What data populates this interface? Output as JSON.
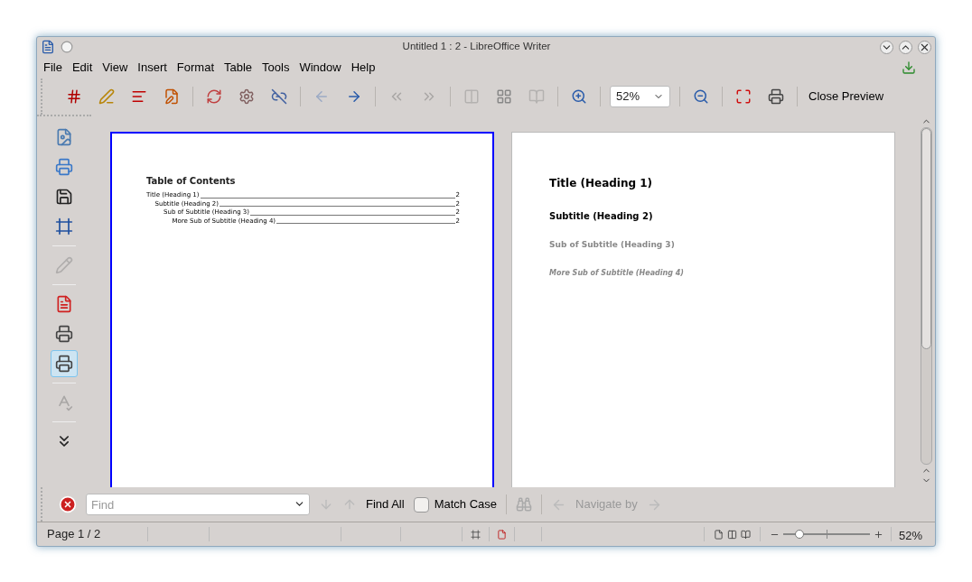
{
  "window": {
    "title": "Untitled 1 : 2 - LibreOffice Writer"
  },
  "menu": [
    {
      "label": "File"
    },
    {
      "label": "Edit"
    },
    {
      "label": "View"
    },
    {
      "label": "Insert"
    },
    {
      "label": "Format"
    },
    {
      "label": "Table"
    },
    {
      "label": "Tools"
    },
    {
      "label": "Window"
    },
    {
      "label": "Help"
    }
  ],
  "toolbar": [
    {
      "kind": "field-number",
      "disabled": false
    },
    {
      "kind": "field-edit",
      "disabled": false
    },
    {
      "kind": "list-lines",
      "disabled": false
    },
    {
      "kind": "list-edit",
      "disabled": false
    },
    {
      "kind": "separator"
    },
    {
      "kind": "refresh",
      "disabled": false
    },
    {
      "kind": "gear",
      "disabled": false
    },
    {
      "kind": "unlink",
      "disabled": false
    },
    {
      "kind": "separator"
    },
    {
      "kind": "arrow-left",
      "disabled": true
    },
    {
      "kind": "arrow-right",
      "disabled": false
    },
    {
      "kind": "separator"
    },
    {
      "kind": "first-page",
      "disabled": true
    },
    {
      "kind": "last-page",
      "disabled": true
    },
    {
      "kind": "separator"
    },
    {
      "kind": "two-pages",
      "disabled": true
    },
    {
      "kind": "multi-page",
      "disabled": false
    },
    {
      "kind": "book",
      "disabled": true
    },
    {
      "kind": "separator"
    },
    {
      "kind": "zoom-in",
      "disabled": false
    },
    {
      "kind": "separator"
    },
    {
      "kind": "zoom-combo",
      "value": "52%"
    },
    {
      "kind": "separator"
    },
    {
      "kind": "zoom-out",
      "disabled": false
    },
    {
      "kind": "separator"
    },
    {
      "kind": "full-screen",
      "disabled": false
    },
    {
      "kind": "print-preview",
      "disabled": false
    },
    {
      "kind": "separator"
    },
    {
      "kind": "text-button",
      "label": "Close Preview"
    }
  ],
  "sidebar": [
    {
      "kind": "image-page",
      "selected": false,
      "disabled": false
    },
    {
      "kind": "printer-menu",
      "selected": false,
      "disabled": false
    },
    {
      "kind": "save",
      "selected": false,
      "disabled": false
    },
    {
      "kind": "frame",
      "selected": false,
      "disabled": false
    },
    {
      "kind": "separator"
    },
    {
      "kind": "pencil",
      "selected": false,
      "disabled": true
    },
    {
      "kind": "separator"
    },
    {
      "kind": "pdf",
      "selected": false,
      "disabled": false
    },
    {
      "kind": "printer",
      "selected": false,
      "disabled": false
    },
    {
      "kind": "print-preview",
      "selected": true,
      "disabled": false
    },
    {
      "kind": "separator"
    },
    {
      "kind": "spellcheck",
      "selected": false,
      "disabled": true
    },
    {
      "kind": "separator"
    },
    {
      "kind": "more",
      "selected": false,
      "disabled": false
    }
  ],
  "pages": [
    {
      "kind": "toc",
      "selected": true,
      "title": "Table of Contents",
      "entries": [
        {
          "text": "Title (Heading 1)",
          "page": "2",
          "children": [
            {
              "text": "Subtitle (Heading 2)",
              "page": "2",
              "children": [
                {
                  "text": "Sub of Subtitle (Heading 3)",
                  "page": "2",
                  "children": [
                    {
                      "text": "More Sub of Subtitle (Heading 4)",
                      "page": "2"
                    }
                  ]
                }
              ]
            }
          ]
        }
      ]
    },
    {
      "kind": "headings",
      "selected": false,
      "headings": [
        {
          "kind": "heading-1",
          "text": "Title (Heading 1)"
        },
        {
          "kind": "heading-2",
          "text": "Subtitle (Heading 2)"
        },
        {
          "kind": "heading-3",
          "text": "Sub of Subtitle (Heading 3)"
        },
        {
          "kind": "heading-4",
          "text": "More Sub of Subtitle (Heading 4)"
        }
      ]
    }
  ],
  "find_bar": {
    "placeholder": "Find",
    "find_all": "Find All",
    "match_case": {
      "label": "Match Case",
      "checked": false
    },
    "navigate_by": {
      "label": "Navigate by",
      "disabled": true
    }
  },
  "status_bar": {
    "page": "Page 1 / 2",
    "zoom_slider": {
      "level": 0.19
    },
    "zoom": "52%"
  }
}
